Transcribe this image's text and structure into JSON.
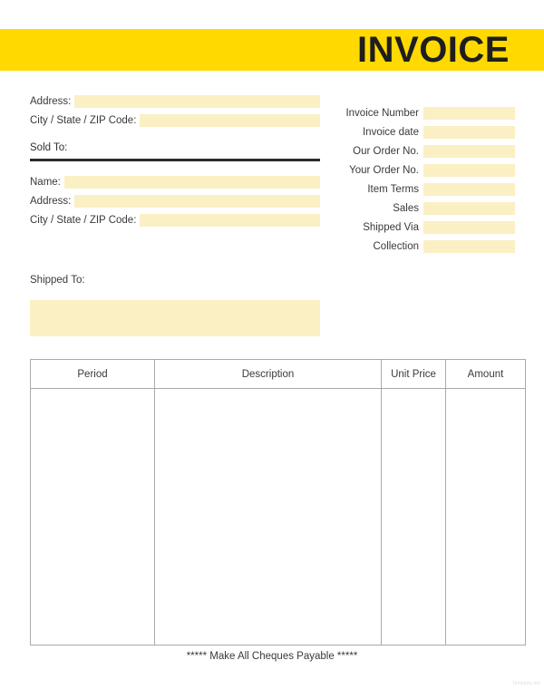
{
  "document": {
    "title": "INVOICE"
  },
  "colors": {
    "banner": "#ffd900",
    "field_fill": "#fbefc4",
    "rule": "#2b2b2b",
    "table_border": "#aaaaaa"
  },
  "sender": {
    "fields": [
      {
        "label": "Address:",
        "value": ""
      },
      {
        "label": "City / State / ZIP Code:",
        "value": ""
      }
    ]
  },
  "sold_to": {
    "heading": "Sold To:",
    "fields": [
      {
        "label": "Name:",
        "value": ""
      },
      {
        "label": "Address:",
        "value": ""
      },
      {
        "label": "City / State / ZIP Code:",
        "value": ""
      }
    ]
  },
  "meta": {
    "fields": [
      {
        "label": "Invoice Number",
        "value": ""
      },
      {
        "label": "Invoice date",
        "value": ""
      },
      {
        "label": "Our Order No.",
        "value": ""
      },
      {
        "label": "Your Order No.",
        "value": ""
      },
      {
        "label": "Item Terms",
        "value": ""
      },
      {
        "label": "Sales",
        "value": ""
      },
      {
        "label": "Shipped Via",
        "value": ""
      },
      {
        "label": "Collection",
        "value": ""
      }
    ]
  },
  "shipped_to": {
    "heading": "Shipped To:",
    "value": ""
  },
  "items_table": {
    "columns": [
      "Period",
      "Description",
      "Unit Price",
      "Amount"
    ],
    "rows": []
  },
  "footer": {
    "note": "***** Make All Cheques Payable *****",
    "watermark": "Template.net"
  }
}
